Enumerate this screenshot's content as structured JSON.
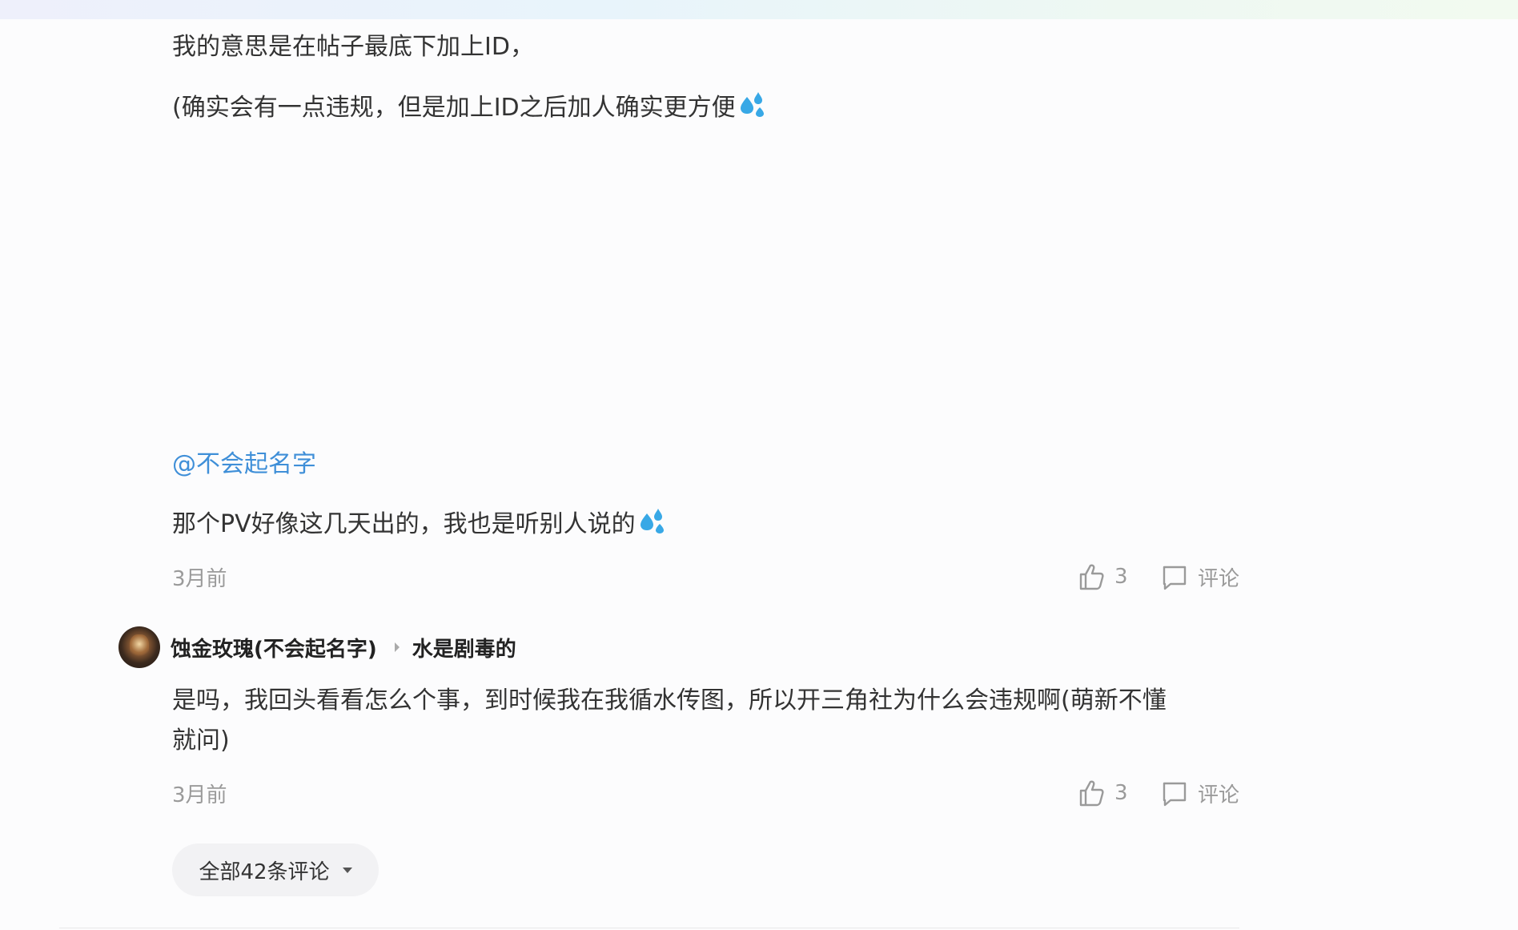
{
  "first_comment": {
    "line1": "我的意思是在帖子最底下加上ID，",
    "line2": "(确实会有一点违规，但是加上ID之后加人确实更方便",
    "line2_emoji": "sweat-droplets-icon"
  },
  "reply1": {
    "mention": "@不会起名字",
    "text": "那个PV好像这几天出的，我也是听别人说的",
    "emoji": "sweat-droplets-icon",
    "time": "3月前",
    "like_count": "3",
    "comment_label": "评论"
  },
  "reply2": {
    "username": "蚀金玫瑰(不会起名字)",
    "reply_to": "水是剧毒的",
    "text_line1": "是吗，我回头看看怎么个事，到时候我在我循水传图，所以开三角社为什么会违规啊(萌新不懂",
    "text_line2": "就问)",
    "time": "3月前",
    "like_count": "3",
    "comment_label": "评论"
  },
  "all_comments_button": {
    "label": "全部42条评论"
  },
  "colors": {
    "mention": "#3f8fd8",
    "text": "#333333",
    "muted": "#9a9a9a",
    "emoji": "#38a8e6"
  }
}
